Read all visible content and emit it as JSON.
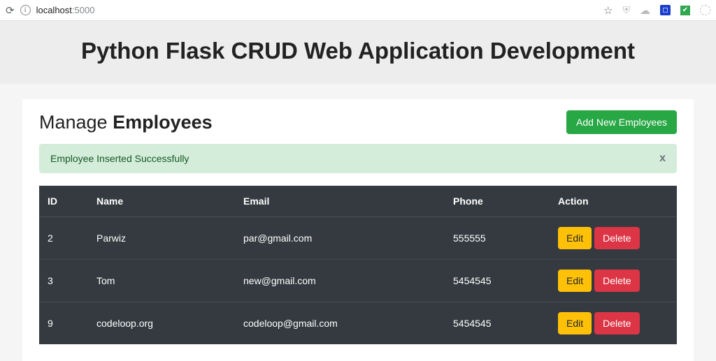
{
  "browser": {
    "url_host": "localhost",
    "url_port": ":5000"
  },
  "header": {
    "title": "Python Flask CRUD Web Application Development"
  },
  "page": {
    "title_prefix": "Manage ",
    "title_strong": "Employees",
    "add_button": "Add New Employees"
  },
  "alert": {
    "message": "Employee Inserted Successfully",
    "close": "x"
  },
  "table": {
    "headers": {
      "id": "ID",
      "name": "Name",
      "email": "Email",
      "phone": "Phone",
      "action": "Action"
    },
    "edit_label": "Edit",
    "delete_label": "Delete",
    "rows": [
      {
        "id": "2",
        "name": "Parwiz",
        "email": "par@gmail.com",
        "phone": "555555"
      },
      {
        "id": "3",
        "name": "Tom",
        "email": "new@gmail.com",
        "phone": "5454545"
      },
      {
        "id": "9",
        "name": "codeloop.org",
        "email": "codeloop@gmail.com",
        "phone": "5454545"
      }
    ]
  }
}
